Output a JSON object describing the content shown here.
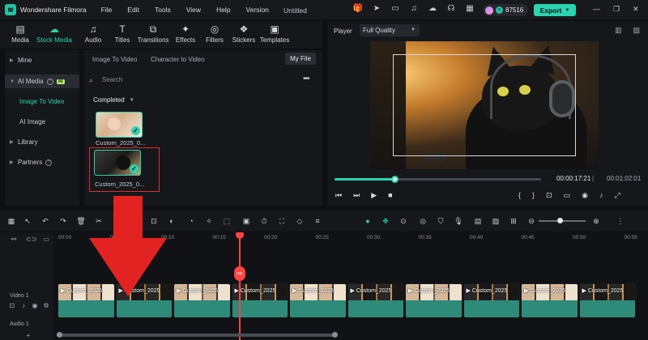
{
  "app": {
    "name": "Wondershare Filmora",
    "doc_title": "Untitled",
    "credits": "87516",
    "export_label": "Export"
  },
  "menus": [
    "File",
    "Edit",
    "Tools",
    "View",
    "Help",
    "Version"
  ],
  "media_tabs": [
    {
      "label": "Media",
      "icon": "folder-icon"
    },
    {
      "label": "Stock Media",
      "icon": "cloud-icon",
      "active": true
    },
    {
      "label": "Audio",
      "icon": "music-icon"
    },
    {
      "label": "Titles",
      "icon": "text-icon"
    },
    {
      "label": "Transitions",
      "icon": "transition-icon"
    },
    {
      "label": "Effects",
      "icon": "effects-icon"
    },
    {
      "label": "Filters",
      "icon": "filter-icon"
    },
    {
      "label": "Stickers",
      "icon": "sticker-icon"
    },
    {
      "label": "Templates",
      "icon": "template-icon"
    }
  ],
  "sidebar": {
    "mine": "Mine",
    "ai_media": "AI Media",
    "ai_badge": "AI",
    "image_to_video": "Image To Video",
    "ai_image": "AI Image",
    "library": "Library",
    "partners": "Partners"
  },
  "browser": {
    "tabs": [
      "Image To Video",
      "Character to Video"
    ],
    "my_file": "My File",
    "search_placeholder": "Search",
    "completed": "Completed",
    "items": [
      {
        "label": "Custom_2025_0..."
      },
      {
        "label": "Custom_2025_0..."
      }
    ]
  },
  "player": {
    "label": "Player",
    "quality": "Full Quality",
    "current_time": "00:00:17:21",
    "separator": "|",
    "total_time": "00:01:02:01",
    "progress": 0.29
  },
  "timeline": {
    "ruler": [
      "00:00",
      "00:00:05",
      "00:10",
      "00:15",
      "00:20",
      "00:25",
      "00:30",
      "00:35",
      "00:40",
      "00:45",
      "00:50",
      "00:55"
    ],
    "video_track": "Video 1",
    "audio_track": "Audio 1",
    "clips": [
      {
        "title": "Custom_2025",
        "kind": "baby"
      },
      {
        "title": "Custom_2025",
        "kind": "cat"
      },
      {
        "title": "Custom_2025",
        "kind": "baby"
      },
      {
        "title": "Custom_2025",
        "kind": "cat"
      },
      {
        "title": "Custom_2025",
        "kind": "baby"
      },
      {
        "title": "Custom_2025",
        "kind": "cat"
      },
      {
        "title": "Custom_2025",
        "kind": "baby"
      },
      {
        "title": "Custom_2025",
        "kind": "cat"
      },
      {
        "title": "Custom_2025",
        "kind": "baby"
      },
      {
        "title": "Custom_2025",
        "kind": "cat"
      }
    ],
    "zoom_level": 0.45
  },
  "colors": {
    "accent": "#2ad4b1",
    "playhead": "#ff4343",
    "highlight": "#e02c2c"
  }
}
